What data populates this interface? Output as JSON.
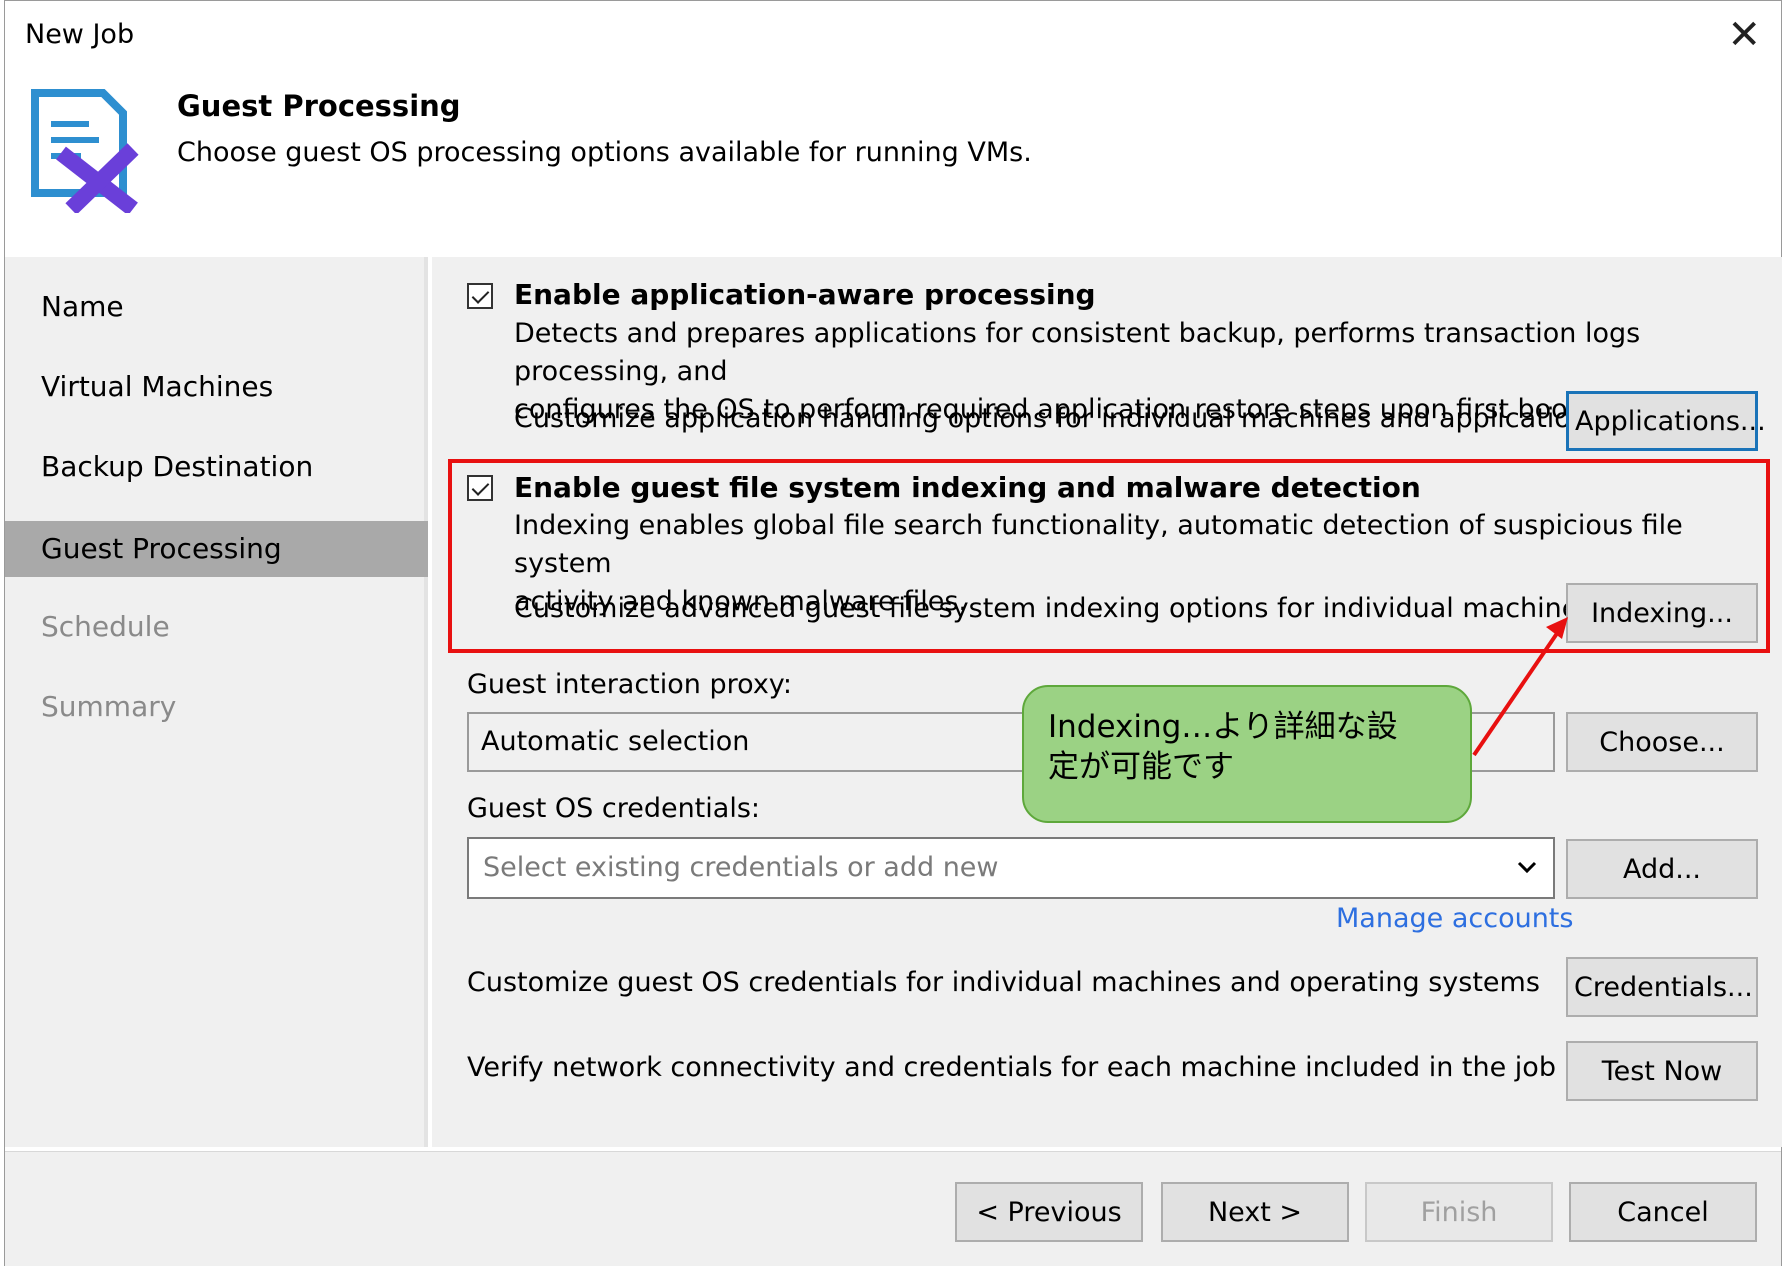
{
  "window": {
    "title": "New Job",
    "close_glyph": "✕"
  },
  "header": {
    "title": "Guest Processing",
    "subtitle": "Choose guest OS processing options available for running VMs."
  },
  "sidebar": {
    "items": [
      {
        "label": "Name",
        "state": "enabled"
      },
      {
        "label": "Virtual Machines",
        "state": "enabled"
      },
      {
        "label": "Backup Destination",
        "state": "enabled"
      },
      {
        "label": "Guest Processing",
        "state": "active"
      },
      {
        "label": "Schedule",
        "state": "disabled"
      },
      {
        "label": "Summary",
        "state": "disabled"
      }
    ]
  },
  "app_aware": {
    "checked": true,
    "label": "Enable application-aware processing",
    "desc_line1": "Detects and prepares applications for consistent backup, performs transaction logs processing, and",
    "desc_line2": "configures the OS to perform required application restore steps upon first boot.",
    "customize": "Customize application handling options for individual machines and applications",
    "button": "Applications..."
  },
  "indexing": {
    "checked": true,
    "label": "Enable guest file system indexing and malware detection",
    "desc_line1": "Indexing enables global file search functionality, automatic detection of suspicious file system",
    "desc_line2": "activity and known malware files.",
    "customize": "Customize advanced guest file system indexing options for individual machines",
    "button": "Indexing..."
  },
  "proxy": {
    "label": "Guest interaction proxy:",
    "value": "Automatic selection",
    "button": "Choose..."
  },
  "credentials": {
    "label": "Guest OS credentials:",
    "placeholder": "Select existing credentials or add new",
    "button": "Add...",
    "manage_link": "Manage accounts",
    "customize": "Customize guest OS credentials for individual machines and operating systems",
    "customize_button": "Credentials..."
  },
  "verify": {
    "text": "Verify network connectivity and credentials for each machine included in the job",
    "button": "Test Now"
  },
  "annotation": {
    "line1": "Indexing…より詳細な設",
    "line2": "定が可能です",
    "color": "#9bd284",
    "arrow_color": "#e81010"
  },
  "footer": {
    "previous": "< Previous",
    "next": "Next >",
    "finish": "Finish",
    "cancel": "Cancel"
  },
  "colors": {
    "highlight_box": "#e81010",
    "link": "#2d6fe0",
    "focus_border": "#1a73b8"
  }
}
